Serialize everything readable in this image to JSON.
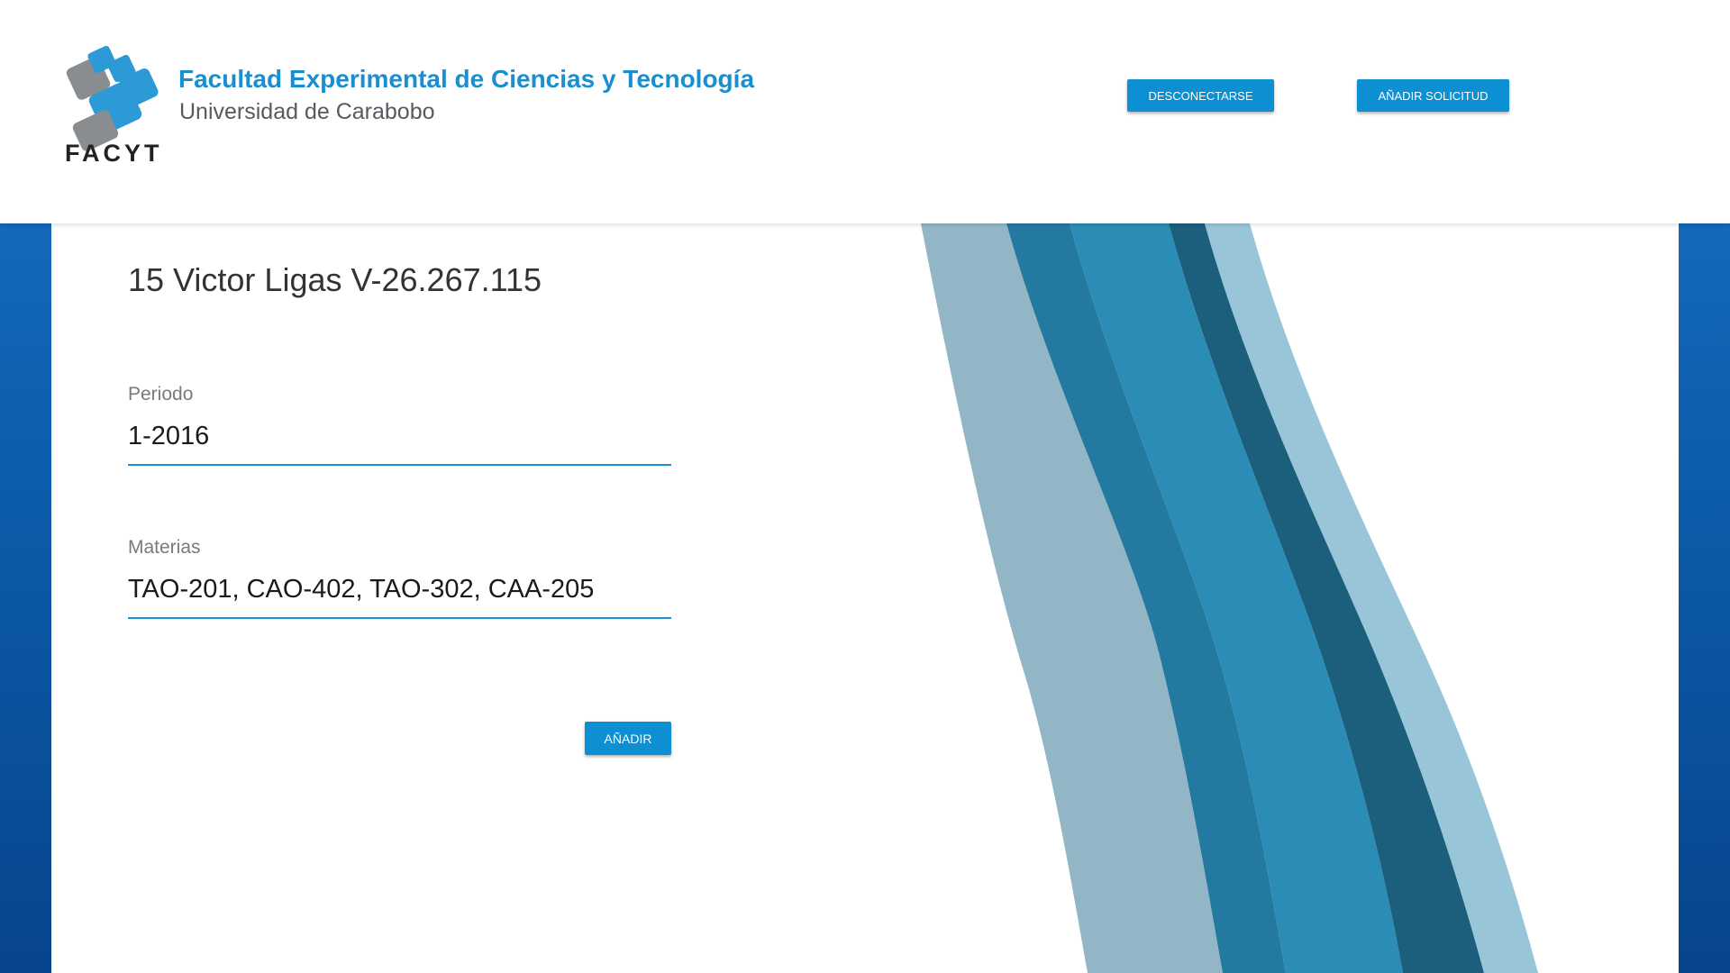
{
  "header": {
    "brand_title": "Facultad Experimental de Ciencias y Tecnología",
    "brand_subtitle": "Universidad de Carabobo",
    "brand_short": "FACYT",
    "logout_label": "DESCONECTARSE",
    "add_request_label": "AÑADIR SOLICITUD"
  },
  "record": {
    "title": "15 Victor Ligas V-26.267.115"
  },
  "form": {
    "periodo_label": "Periodo",
    "periodo_value": "1-2016",
    "materias_label": "Materias",
    "materias_value": "TAO-201, CAO-402, TAO-302, CAA-205",
    "submit_label": "AÑADIR"
  },
  "colors": {
    "accent": "#0c8fd3",
    "brand_blue": "#1a8fd0",
    "background_blue": "#0c5aa8",
    "wave_light": "#93b6c7",
    "wave_mid": "#2479a0",
    "wave_bright": "#2b8db5",
    "wave_dark": "#1c5f7d",
    "wave_pale": "#98c6d8"
  },
  "icons": {
    "logo": "facyt-logo-icon"
  }
}
